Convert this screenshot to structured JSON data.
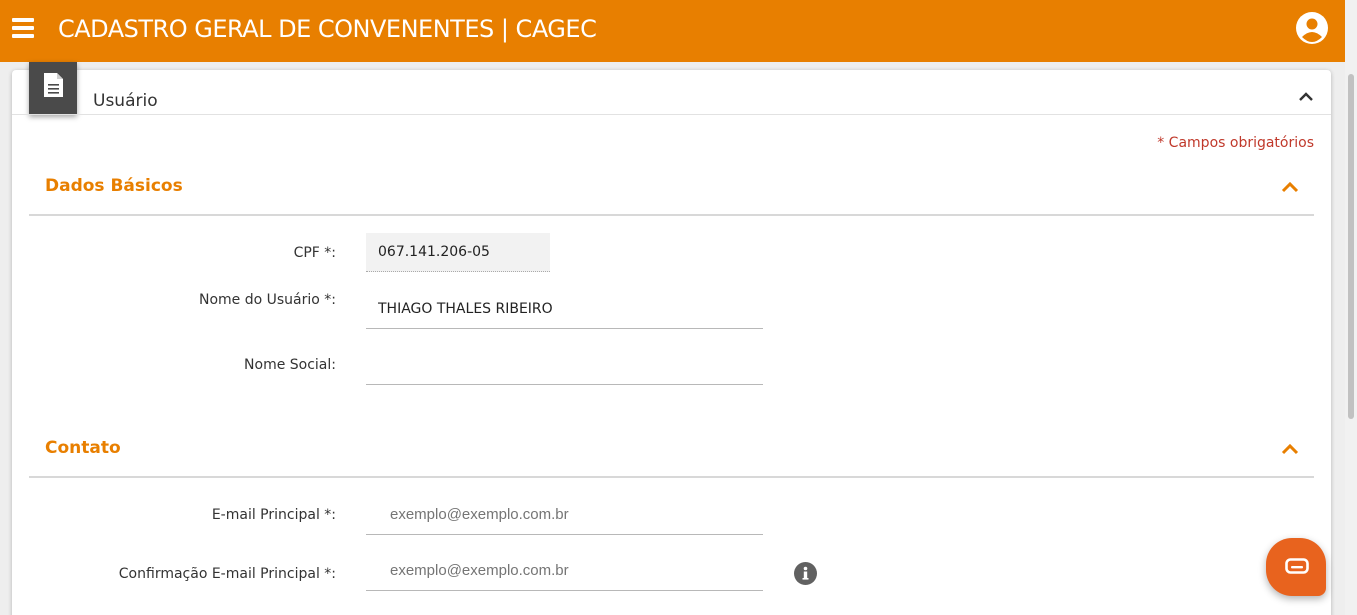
{
  "header": {
    "title": "CADASTRO GERAL DE CONVENENTES | CAGEC",
    "menu_icon": "hamburger-menu-icon",
    "user_icon": "account-circle-icon",
    "background_color": "#e87f00"
  },
  "card": {
    "title": "Usuário",
    "badge_icon": "document-icon",
    "required_note": "* Campos obrigatórios"
  },
  "sections": {
    "basic": {
      "title": "Dados Básicos",
      "fields": {
        "cpf": {
          "label": "CPF *:",
          "value": "067.141.206-05"
        },
        "name": {
          "label": "Nome do Usuário *:",
          "value": "THIAGO THALES RIBEIRO"
        },
        "social_name": {
          "label": "Nome Social:",
          "value": ""
        }
      }
    },
    "contact": {
      "title": "Contato",
      "fields": {
        "email": {
          "label": "E-mail Principal *:",
          "placeholder": "exemplo@exemplo.com.br"
        },
        "email_confirm": {
          "label": "Confirmação E-mail Principal *:",
          "placeholder": "exemplo@exemplo.com.br"
        }
      }
    }
  },
  "widgets": {
    "info_icon": "info-icon",
    "chat_icon": "chat-bubble-icon",
    "accent_color": "#e87f00",
    "chat_color": "#e8631e"
  }
}
